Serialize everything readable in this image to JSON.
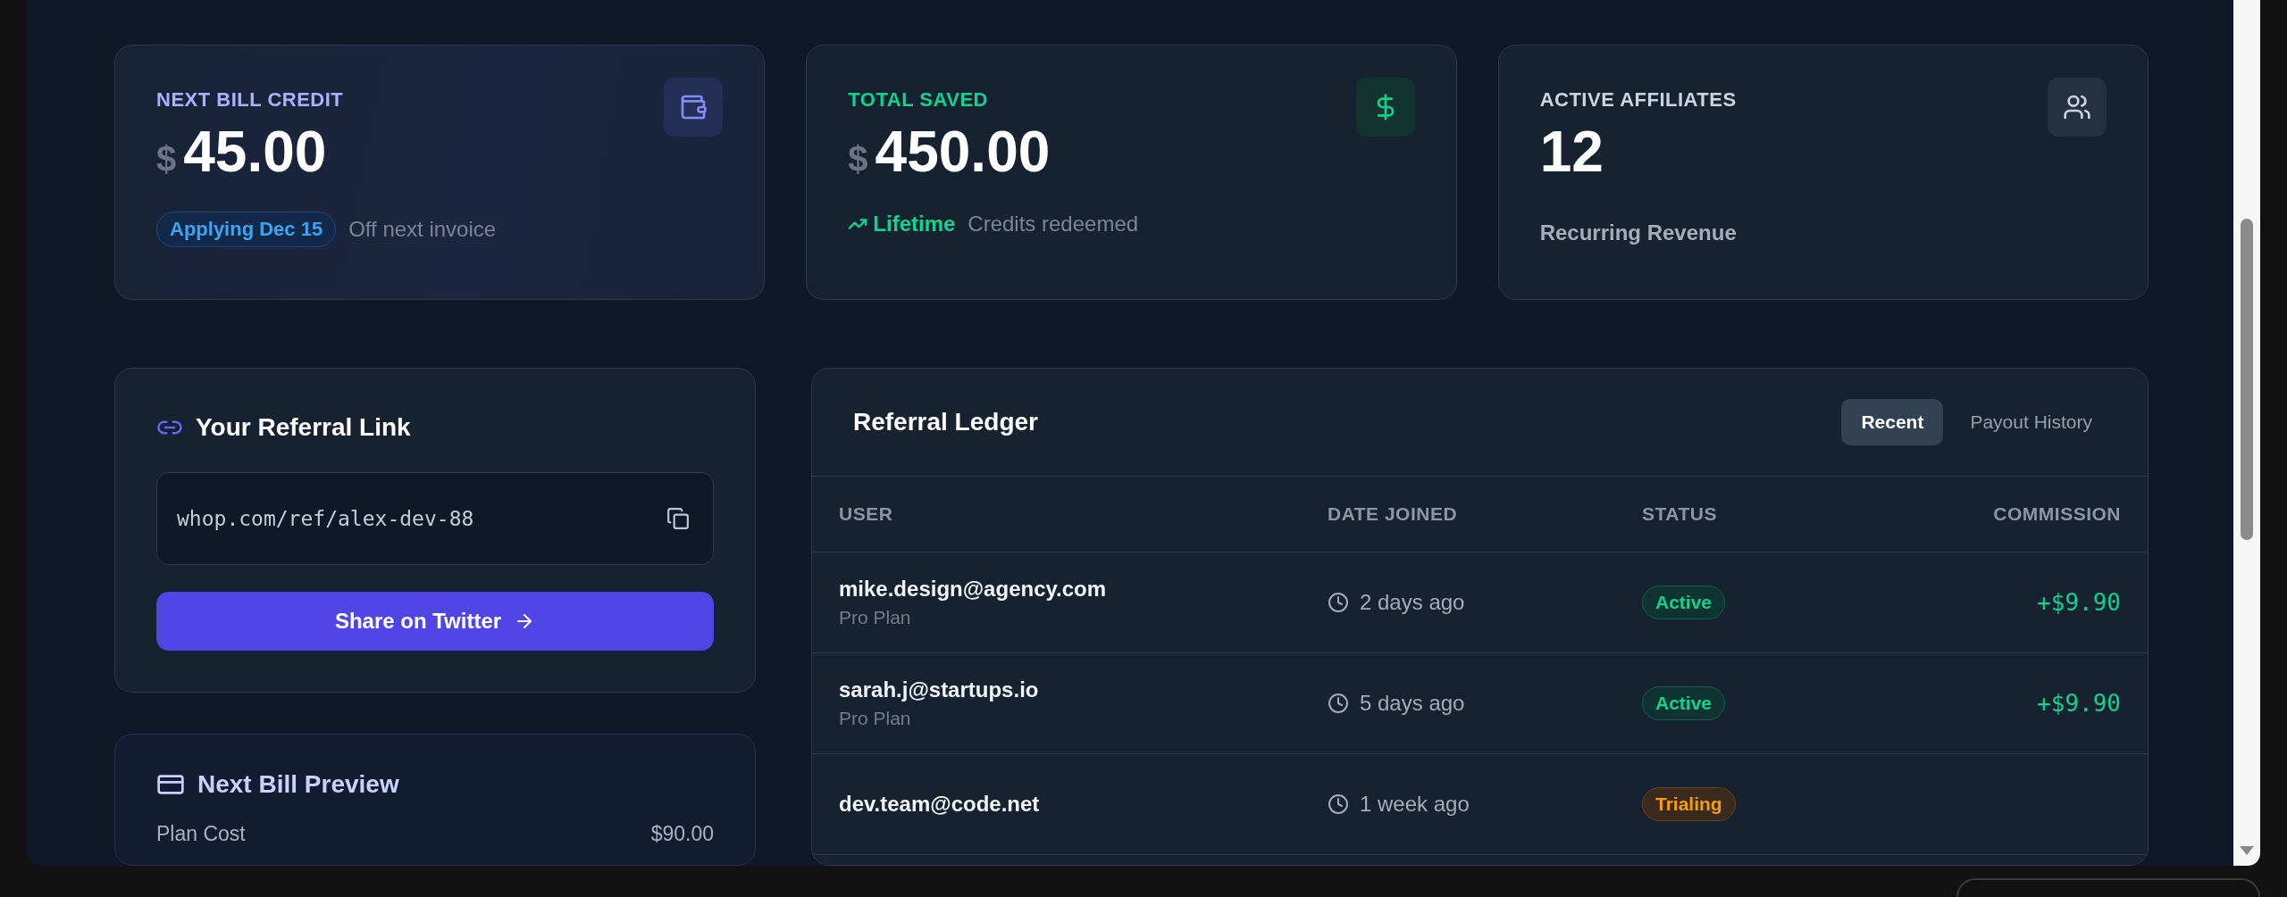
{
  "stats": [
    {
      "kind": "credit",
      "label": "NEXT BILL CREDIT",
      "color": "#a5b4fc",
      "currency": "$",
      "value": "45.00",
      "badge": "Applying Dec 15",
      "note": "Off next invoice"
    },
    {
      "kind": "saved",
      "label": "TOTAL SAVED",
      "color": "#10d48e",
      "currency": "$",
      "value": "450.00",
      "trend": "Lifetime",
      "note": "Credits redeemed"
    },
    {
      "kind": "affiliates",
      "label": "ACTIVE AFFILIATES",
      "color": "#cbd5e1",
      "value": "12",
      "note": "Recurring Revenue"
    }
  ],
  "referral": {
    "title": "Your Referral Link",
    "link": "whop.com/ref/alex-dev-88",
    "button": "Share on Twitter"
  },
  "bill_preview": {
    "title": "Next Bill Preview",
    "rows": [
      {
        "label": "Plan Cost",
        "value": "$90.00"
      }
    ]
  },
  "ledger": {
    "title": "Referral Ledger",
    "tabs": [
      {
        "label": "Recent",
        "selected": true
      },
      {
        "label": "Payout History",
        "selected": false
      }
    ],
    "columns": [
      "USER",
      "DATE JOINED",
      "STATUS",
      "COMMISSION"
    ],
    "rows": [
      {
        "user": "mike.design@agency.com",
        "plan": "Pro Plan",
        "date": "2 days ago",
        "status": {
          "kind": "active",
          "label": "Active"
        },
        "commission": "+$9.90"
      },
      {
        "user": "sarah.j@startups.io",
        "plan": "Pro Plan",
        "date": "5 days ago",
        "status": {
          "kind": "active",
          "label": "Active"
        },
        "commission": "+$9.90"
      },
      {
        "user": "dev.team@code.net",
        "date": "1 week ago",
        "status": {
          "kind": "trialing",
          "label": "Trialing"
        }
      }
    ]
  }
}
